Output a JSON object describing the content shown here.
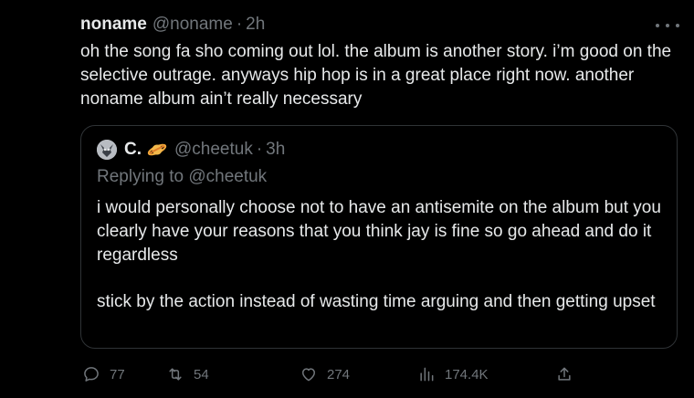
{
  "tweet": {
    "author_name": "noname",
    "author_handle": "@noname",
    "separator": "·",
    "time": "2h",
    "text": "oh the song fa sho coming out lol. the album is another story. i’m good on the selective outrage. anyways hip hop is in a great place right now. another noname album ain’t really necessary"
  },
  "quote": {
    "name": "C.",
    "handle": "@cheetuk",
    "separator": "·",
    "time": "3h",
    "replying_prefix": "Replying to ",
    "replying_handle": "@cheetuk",
    "text_p1": "i would personally choose not to have an antisemite on the album but you clearly have your reasons that you think jay is fine so go ahead and do it regardless",
    "text_p2": "stick by the action instead of wasting time arguing and then getting upset"
  },
  "actions": {
    "replies": "77",
    "retweets": "54",
    "likes": "274",
    "views": "174.4K"
  },
  "colors": {
    "background": "#000000",
    "text": "#e7e9ea",
    "muted": "#71767b",
    "border": "#2f3336"
  },
  "icons": {
    "more": "more-dots-icon",
    "reply": "reply-bubble-icon",
    "retweet": "retweet-icon",
    "like": "heart-icon",
    "views": "bar-chart-icon",
    "share": "share-upload-icon",
    "planet": "ringed-planet-emoji-icon"
  }
}
